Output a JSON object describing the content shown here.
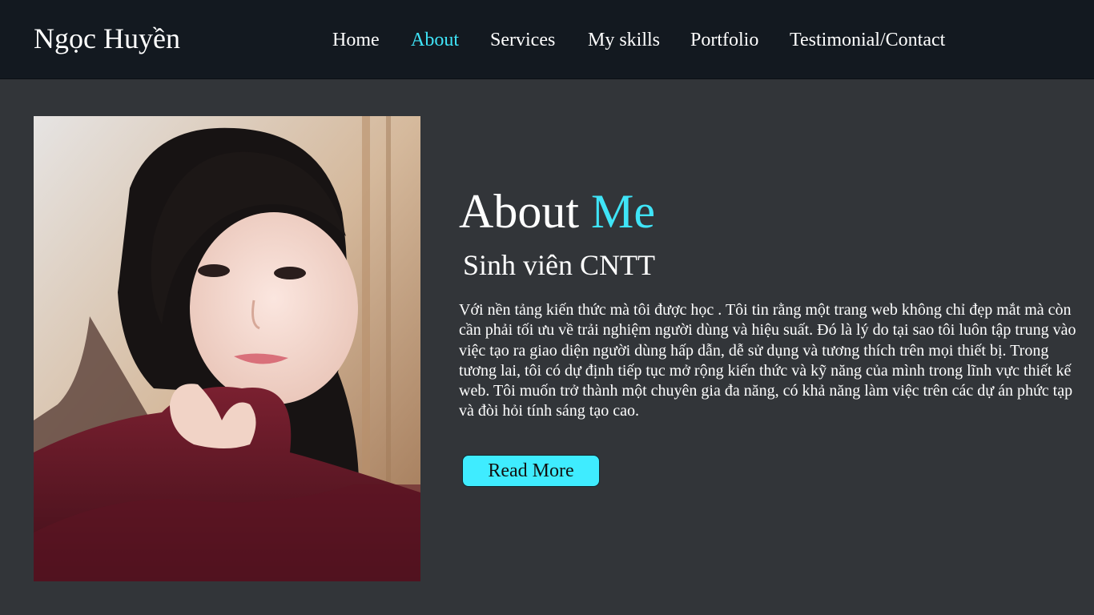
{
  "header": {
    "brand": "Ngọc Huyền",
    "nav": [
      {
        "label": "Home",
        "active": false
      },
      {
        "label": "About",
        "active": true
      },
      {
        "label": "Services",
        "active": false
      },
      {
        "label": "My skills",
        "active": false
      },
      {
        "label": "Portfolio",
        "active": false
      },
      {
        "label": "Testimonial/Contact",
        "active": false
      }
    ]
  },
  "about": {
    "title_main": "About ",
    "title_accent": "Me",
    "subtitle": "Sinh viên CNTT",
    "description": "Với nền tảng kiến thức mà tôi được học . Tôi tin rằng một trang web không chỉ đẹp mắt mà  còn cần phải tối ưu về trải nghiệm người dùng và hiệu suất. Đó là lý do tại sao tôi luôn tập trung vào việc tạo ra giao diện người dùng hấp dẫn, dễ sử dụng và tương thích trên mọi thiết bị. Trong tương lai, tôi có dự định tiếp tục mở rộng kiến thức và kỹ năng của mình trong lĩnh vực thiết kế web. Tôi muốn trở thành một chuyên gia đa năng, có khả năng làm việc trên các  dự án phức tạp và đòi hỏi tính sáng tạo cao.",
    "button_label": "Read More"
  },
  "colors": {
    "accent": "#3fe4f7",
    "header_bg": "#131920",
    "page_bg": "#323539",
    "button_bg": "#3fecff"
  }
}
